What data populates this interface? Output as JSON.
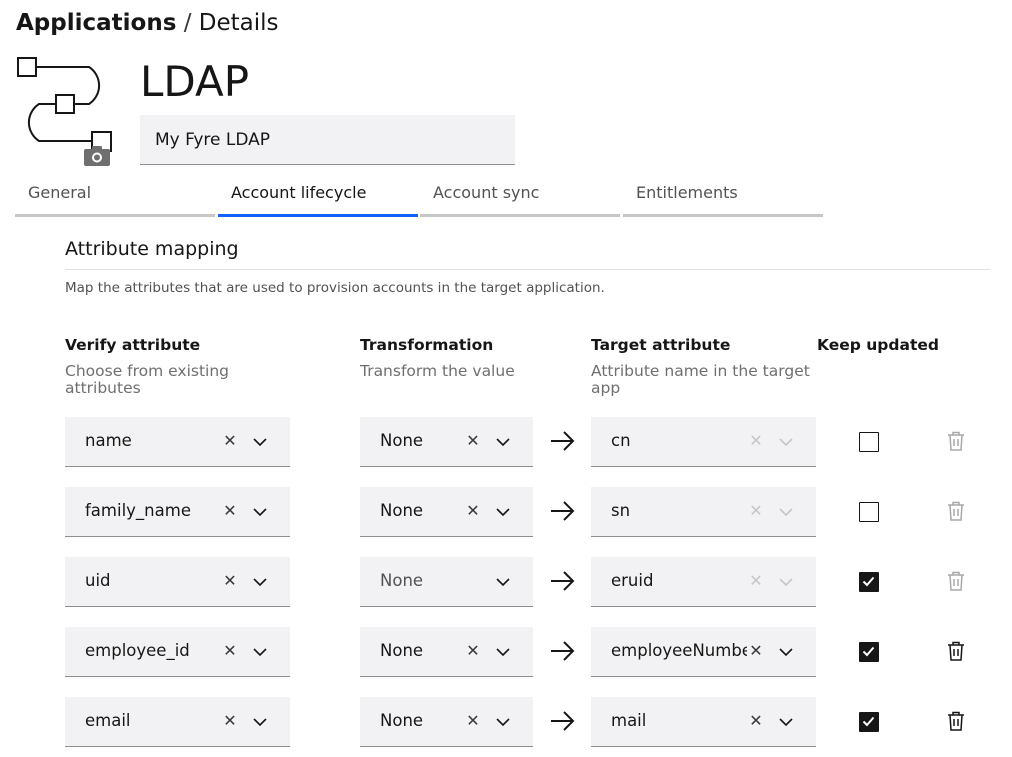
{
  "breadcrumb": {
    "parent": "Applications",
    "separator": "/",
    "current": "Details"
  },
  "app": {
    "title": "LDAP",
    "name_value": "My Fyre LDAP"
  },
  "tabs": [
    {
      "label": "General",
      "active": false
    },
    {
      "label": "Account lifecycle",
      "active": true
    },
    {
      "label": "Account sync",
      "active": false
    },
    {
      "label": "Entitlements",
      "active": false
    }
  ],
  "section": {
    "title": "Attribute mapping",
    "description": "Map the attributes that are used to provision accounts in the target application."
  },
  "columns": {
    "verify": {
      "title": "Verify attribute",
      "subtitle": "Choose from existing attributes"
    },
    "transform": {
      "title": "Transformation",
      "subtitle": "Transform the value"
    },
    "target": {
      "title": "Target attribute",
      "subtitle": "Attribute name in the target app"
    },
    "keep": {
      "title": "Keep updated"
    }
  },
  "rows": [
    {
      "verify": "name",
      "transform": "None",
      "target": "cn",
      "target_editable": false,
      "keep_updated": false,
      "delete_enabled": false
    },
    {
      "verify": "family_name",
      "transform": "None",
      "target": "sn",
      "target_editable": false,
      "keep_updated": false,
      "delete_enabled": false
    },
    {
      "verify": "uid",
      "transform": "None",
      "target": "eruid",
      "target_editable": false,
      "keep_updated": true,
      "delete_enabled": false
    },
    {
      "verify": "employee_id",
      "transform": "None",
      "target": "employeeNumber",
      "target_editable": true,
      "keep_updated": true,
      "delete_enabled": true
    },
    {
      "verify": "email",
      "transform": "None",
      "target": "mail",
      "target_editable": true,
      "keep_updated": true,
      "delete_enabled": true
    }
  ],
  "icons": {
    "clear": "close-icon",
    "dropdown": "chevron-down-icon",
    "arrow": "arrow-right-icon",
    "delete": "trash-icon",
    "logo": "flow-icon",
    "camera": "camera-icon"
  },
  "colors": {
    "accent": "#0f62fe",
    "field_bg": "#f2f2f4",
    "text": "#161616",
    "muted": "#6f6f6f"
  }
}
